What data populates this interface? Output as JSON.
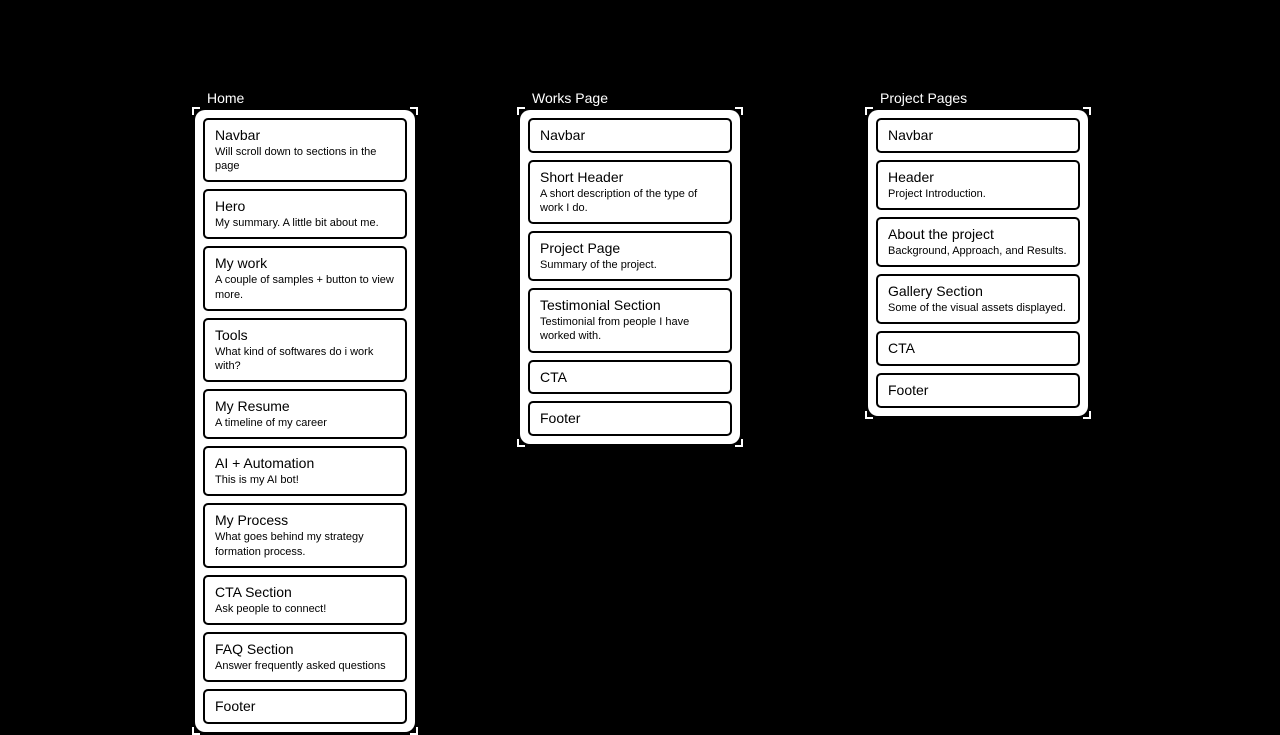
{
  "pages": [
    {
      "title": "Home",
      "sections": [
        {
          "title": "Navbar",
          "desc": "Will scroll down to sections in the page"
        },
        {
          "title": "Hero",
          "desc": "My summary. A little bit about me."
        },
        {
          "title": "My work",
          "desc": "A couple of samples + button to view more."
        },
        {
          "title": "Tools",
          "desc": "What kind of softwares do i work with?"
        },
        {
          "title": "My Resume",
          "desc": "A timeline of my career"
        },
        {
          "title": "AI + Automation",
          "desc": "This is my AI bot!"
        },
        {
          "title": "My Process",
          "desc": "What goes behind my strategy formation process."
        },
        {
          "title": "CTA Section",
          "desc": "Ask people to connect!"
        },
        {
          "title": "FAQ Section",
          "desc": "Answer frequently asked questions"
        },
        {
          "title": "Footer"
        }
      ]
    },
    {
      "title": "Works Page",
      "sections": [
        {
          "title": "Navbar"
        },
        {
          "title": "Short Header",
          "desc": "A short description of the type of work I do."
        },
        {
          "title": "Project Page",
          "desc": "Summary of the project."
        },
        {
          "title": "Testimonial Section",
          "desc": "Testimonial from people I have worked with."
        },
        {
          "title": "CTA"
        },
        {
          "title": "Footer"
        }
      ]
    },
    {
      "title": "Project Pages",
      "sections": [
        {
          "title": "Navbar"
        },
        {
          "title": "Header",
          "desc": "Project Introduction."
        },
        {
          "title": "About the project",
          "desc": "Background, Approach, and Results."
        },
        {
          "title": "Gallery Section",
          "desc": "Some of the visual assets displayed."
        },
        {
          "title": "CTA"
        },
        {
          "title": "Footer"
        }
      ]
    }
  ]
}
